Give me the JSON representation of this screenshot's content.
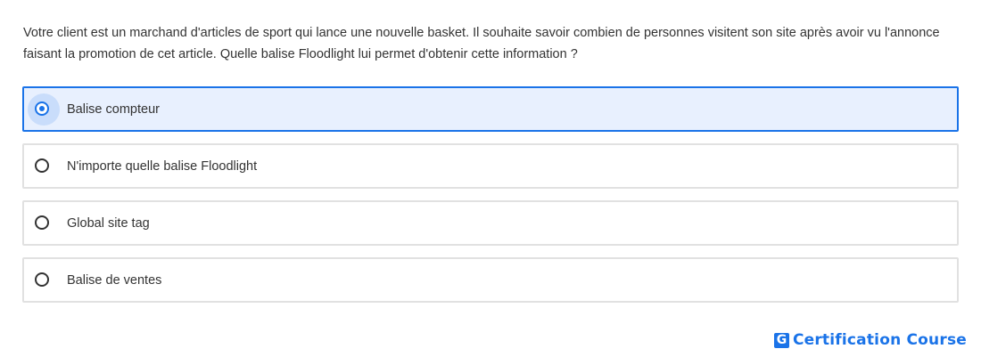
{
  "question": {
    "text": "Votre client est un marchand d'articles de sport qui lance une nouvelle basket. Il souhaite savoir combien de personnes visitent son site après avoir vu l'annonce faisant la promotion de cet article. Quelle balise Floodlight lui permet d'obtenir cette information ?"
  },
  "options": [
    {
      "label": "Balise compteur",
      "selected": true
    },
    {
      "label": "N'importe quelle balise Floodlight",
      "selected": false
    },
    {
      "label": "Global site tag",
      "selected": false
    },
    {
      "label": "Balise de ventes",
      "selected": false
    }
  ],
  "brand": {
    "logo_letter": "G",
    "name": "Certification Course",
    "color": "#1a73e8"
  },
  "colors": {
    "accent": "#1a73e8",
    "selected_background": "#e8f0fe",
    "border": "#e1e1e1",
    "text": "#333333"
  }
}
